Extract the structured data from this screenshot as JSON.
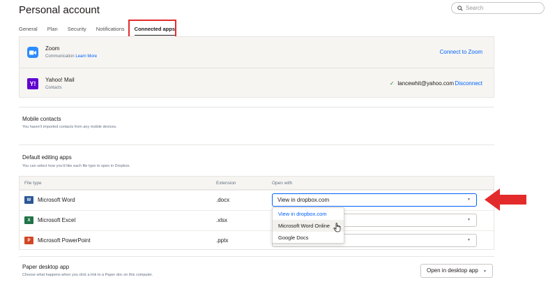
{
  "page": {
    "title": "Personal account"
  },
  "search": {
    "placeholder": "Search"
  },
  "tabs": [
    {
      "label": "General"
    },
    {
      "label": "Plan"
    },
    {
      "label": "Security"
    },
    {
      "label": "Notifications"
    },
    {
      "label": "Connected apps"
    }
  ],
  "connected_apps": [
    {
      "name": "Zoom",
      "category": "Communication",
      "link": "Learn More",
      "action": "Connect to Zoom"
    },
    {
      "name": "Yahoo! Mail",
      "category": "Contacts",
      "account": "lancewhit@yahoo.com",
      "action": "Disconnect"
    }
  ],
  "mobile_contacts": {
    "title": "Mobile contacts",
    "subtitle": "You haven't imported contacts from any mobile devices."
  },
  "default_apps": {
    "title": "Default editing apps",
    "subtitle": "You can select how you'd like each file type to open in Dropbox.",
    "headers": {
      "file_type": "File type",
      "extension": "Extension",
      "open_with": "Open with"
    },
    "rows": [
      {
        "icon": "W",
        "name": "Microsoft Word",
        "extension": ".docx",
        "open_with": "View in dropbox.com"
      },
      {
        "icon": "X",
        "name": "Microsoft Excel",
        "extension": ".xlsx",
        "open_with": ""
      },
      {
        "icon": "P",
        "name": "Microsoft PowerPoint",
        "extension": ".pptx",
        "open_with": ""
      }
    ],
    "dropdown_options": [
      "View in dropbox.com",
      "Microsoft Word Online",
      "Google Docs"
    ]
  },
  "paper": {
    "title": "Paper desktop app",
    "subtitle": "Choose what happens when you click a link to a Paper doc on this computer.",
    "button": "Open in desktop app"
  },
  "colors": {
    "accent": "#0061fe",
    "highlight": "#e32b2b",
    "panel": "#f7f5f2"
  }
}
